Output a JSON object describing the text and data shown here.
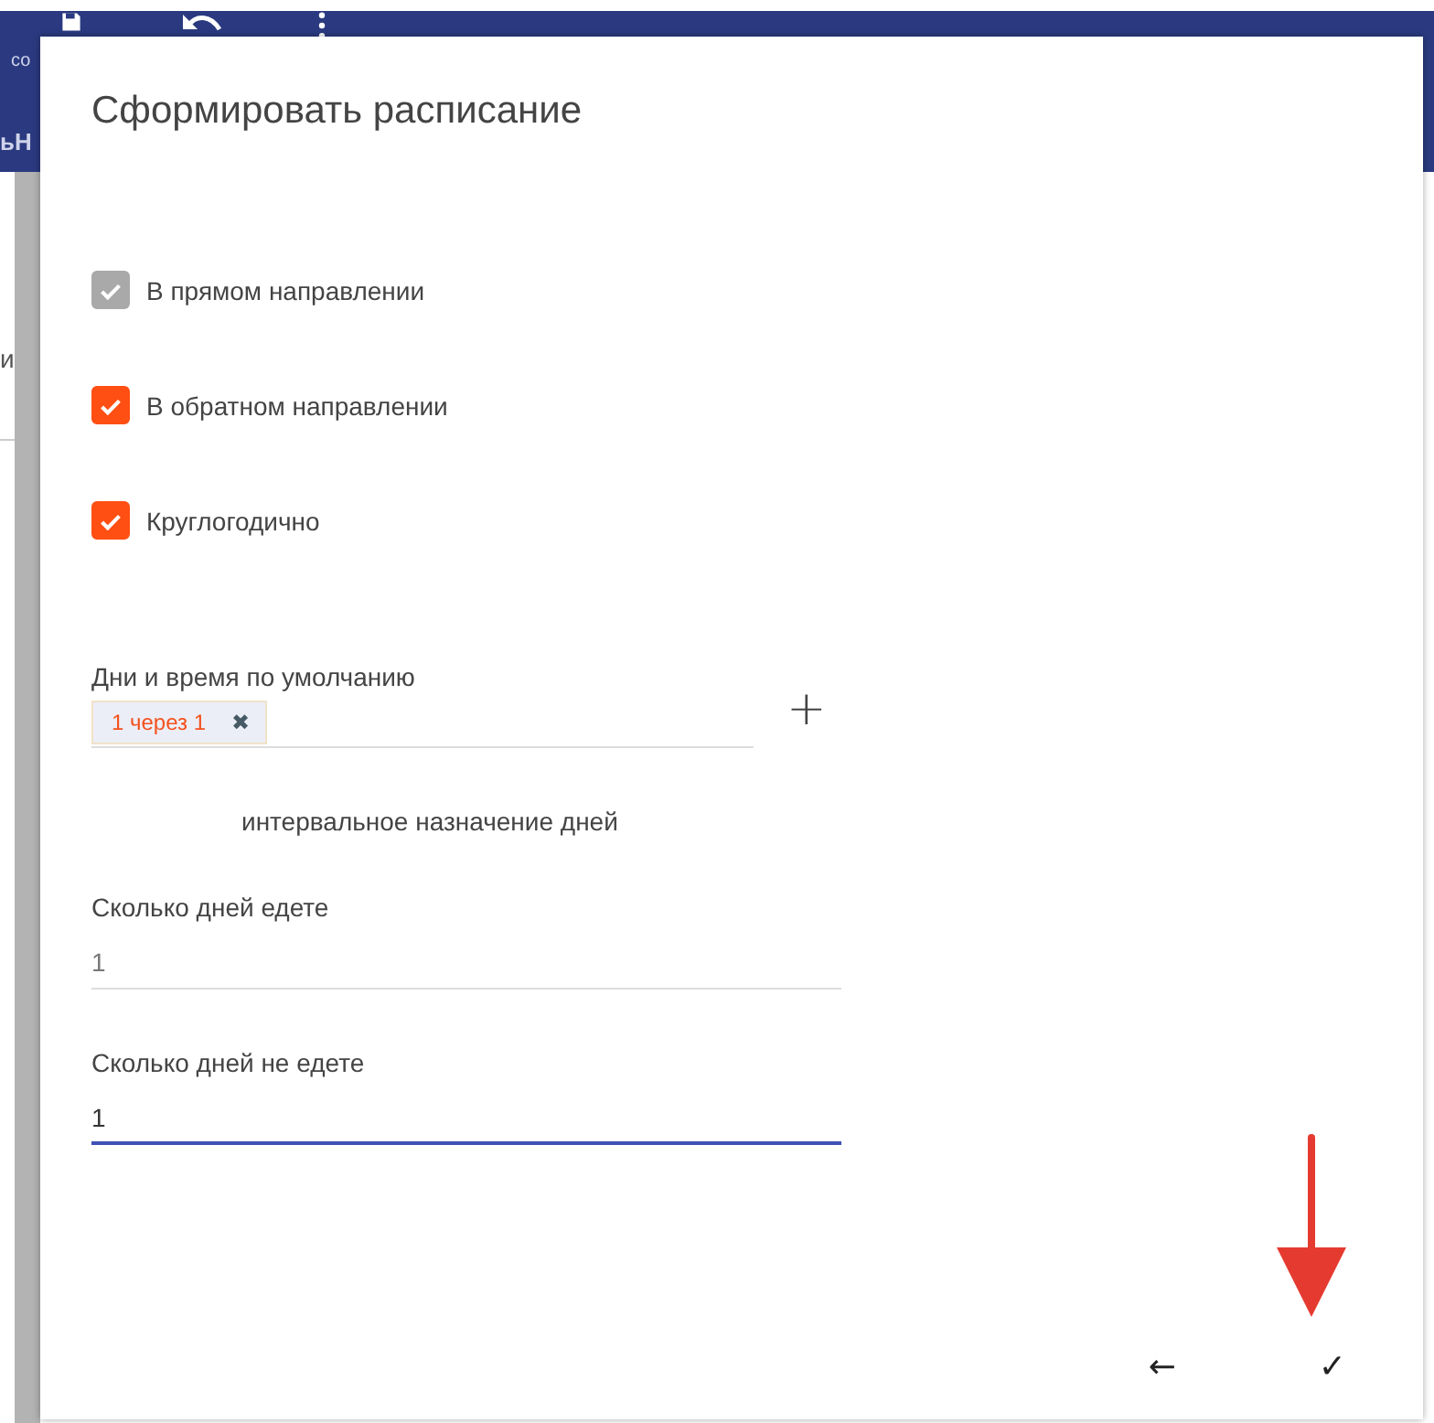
{
  "background": {
    "fragments": [
      "со",
      "ьН",
      "и"
    ]
  },
  "dialog": {
    "title": "Сформировать расписание",
    "checkboxes": [
      {
        "label": "В прямом направлении",
        "checked": true,
        "disabled": true
      },
      {
        "label": "В обратном направлении",
        "checked": true,
        "disabled": false
      },
      {
        "label": "Круглогодично",
        "checked": true,
        "disabled": false
      }
    ],
    "default_days": {
      "label": "Дни и время по умолчанию",
      "chips": [
        {
          "text": "1 через 1",
          "remove": "✖"
        }
      ],
      "add": "+"
    },
    "section_title": "интервальное назначение дней",
    "fields": [
      {
        "label": "Сколько дней едете",
        "value": "1",
        "focused": false
      },
      {
        "label": "Сколько дней не едете",
        "value": "1",
        "focused": true
      }
    ],
    "actions": {
      "back": "←",
      "confirm": "✓"
    }
  }
}
